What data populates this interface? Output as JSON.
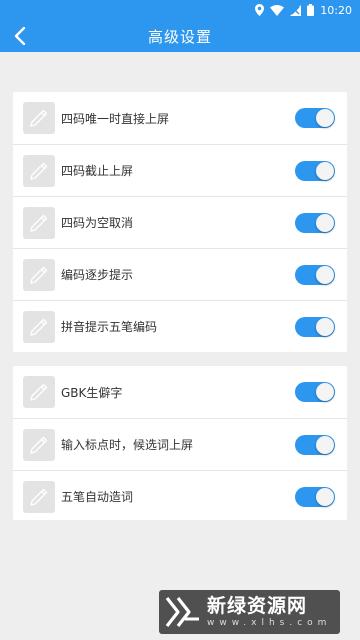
{
  "status_bar": {
    "time": "10:20",
    "icons": [
      "location-icon",
      "wifi-icon",
      "signal-icon",
      "battery-icon"
    ]
  },
  "app_bar": {
    "title": "高级设置",
    "back_icon": "chevron-left-icon"
  },
  "settings": {
    "group1": [
      {
        "label": "四码唯一时直接上屏",
        "enabled": true
      },
      {
        "label": "四码截止上屏",
        "enabled": true
      },
      {
        "label": "四码为空取消",
        "enabled": true
      },
      {
        "label": "编码逐步提示",
        "enabled": true
      },
      {
        "label": "拼音提示五笔编码",
        "enabled": true
      }
    ],
    "group2": [
      {
        "label": "GBK生僻字",
        "enabled": true
      },
      {
        "label": "输入标点时，候选词上屏",
        "enabled": true
      },
      {
        "label": "五笔自动造词",
        "enabled": true
      }
    ]
  },
  "watermark": {
    "main": "新绿资源网",
    "sub": "www.xlhs.com"
  },
  "colors": {
    "primary": "#2d96ef",
    "background": "#eeeeee",
    "card": "#ffffff",
    "icon_bg": "#e3e3e3"
  }
}
